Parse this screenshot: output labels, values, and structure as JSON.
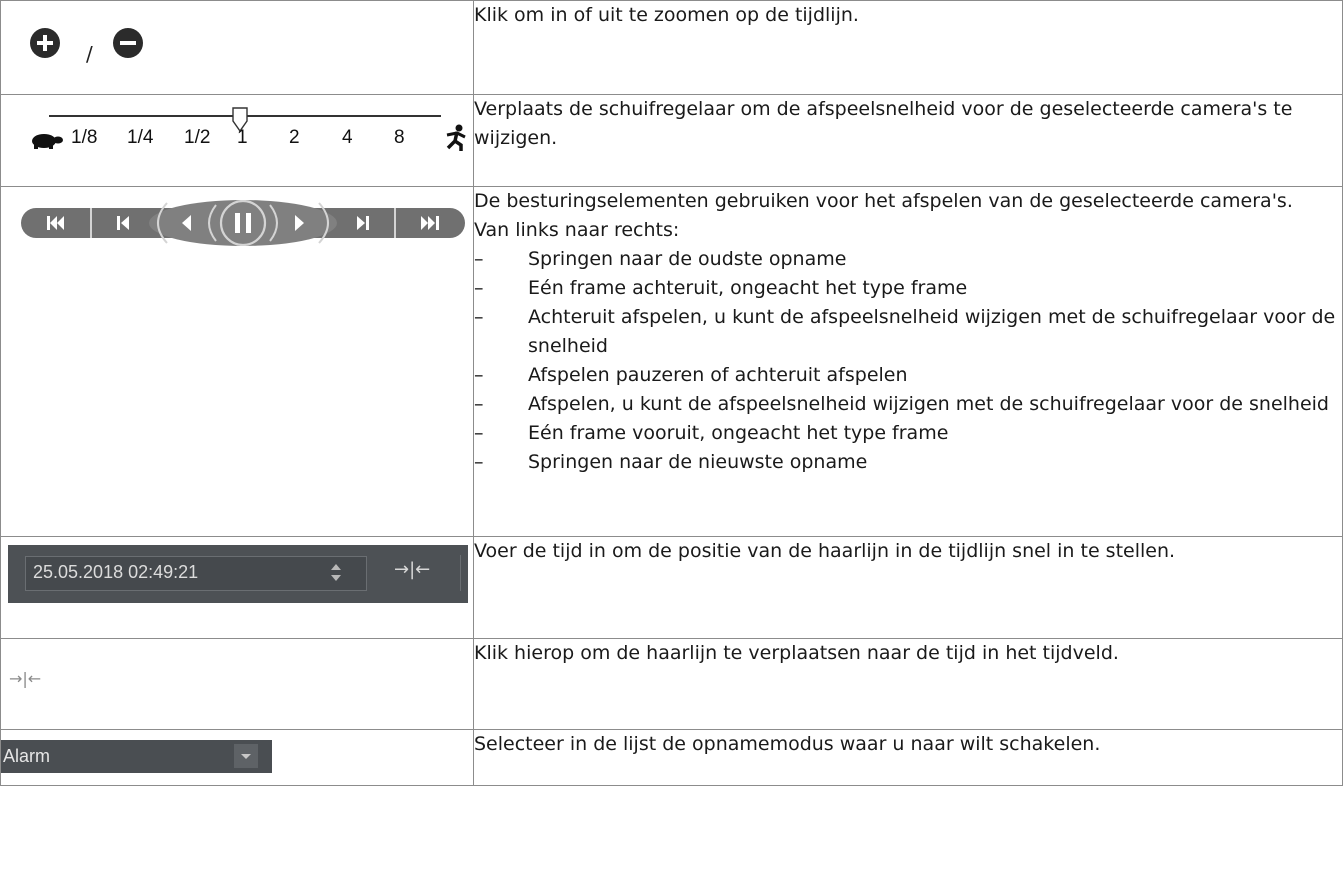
{
  "rows": [
    {
      "icons": [
        "zoom-in-icon",
        "zoom-out-icon"
      ],
      "separator": "/",
      "text": "Klik om in of uit te zoomen op de tijdlijn."
    },
    {
      "slider": {
        "labels": [
          "1/8",
          "1/4",
          "1/2",
          "1",
          "2",
          "4",
          "8"
        ],
        "selected": "1",
        "slow_icon": "turtle-icon",
        "fast_icon": "runner-icon"
      },
      "text": "Verplaats de schuifregelaar om de afspeelsnelheid voor de geselecteerde camera's te wijzigen."
    },
    {
      "buttons": [
        "jump-oldest-icon",
        "step-back-icon",
        "play-reverse-icon",
        "pause-icon",
        "play-icon",
        "step-forward-icon",
        "jump-newest-icon"
      ],
      "text_intro": "De besturingselementen gebruiken voor het afspelen van de geselecteerde camera's.",
      "text_sub": "Van links naar rechts:",
      "dash": "–",
      "items": [
        "Springen naar de oudste opname",
        "Eén frame achteruit, ongeacht het type frame",
        "Achteruit afspelen, u kunt de afspeelsnelheid wijzigen met de schuifregelaar voor de snelheid",
        "Afspelen pauzeren of achteruit afspelen",
        "Afspelen, u kunt de afspeelsnelheid wijzigen met de schuifregelaar voor de snelheid",
        "Eén frame vooruit, ongeacht het type frame",
        "Springen naar de nieuwste opname"
      ]
    },
    {
      "datetime_value": "25.05.2018 02:49:21",
      "jump_glyph": "→|←",
      "text": "Voer de tijd in om de positie van de haarlijn in de tijdlijn snel in te stellen."
    },
    {
      "jump_glyph": "→|←",
      "text": "Klik hierop om de haarlijn te verplaatsen naar de tijd in het tijdveld."
    },
    {
      "select_value": "Alarm",
      "text": "Selecteer in de lijst de opnamemodus waar u naar wilt schakelen."
    }
  ],
  "colors": {
    "border": "#8c8c8c",
    "icon_dark": "#2b2b2b",
    "control_grey": "#6f6f6f",
    "panel_dark": "#4d5155"
  }
}
